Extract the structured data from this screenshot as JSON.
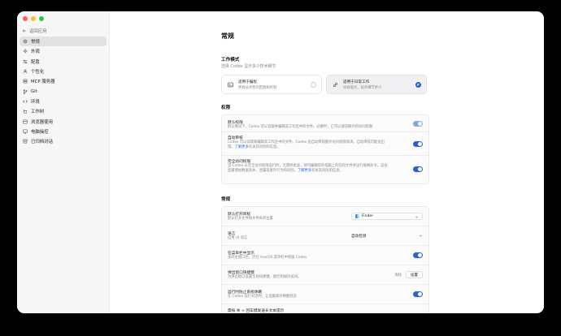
{
  "colors": {
    "accent": "#2a62d0",
    "close": "#ff5f57",
    "minimize": "#febc2e",
    "maximize": "#28c840"
  },
  "sidebar": {
    "back_label": "返回应用",
    "items": [
      {
        "label": "常规",
        "icon": "gear-icon",
        "active": true
      },
      {
        "label": "外观",
        "icon": "sun-icon"
      },
      {
        "label": "配置",
        "icon": "sliders-icon"
      },
      {
        "label": "个性化",
        "icon": "user-icon"
      },
      {
        "label": "MCP 服务器",
        "icon": "server-icon"
      },
      {
        "label": "Git",
        "icon": "git-branch-icon"
      },
      {
        "label": "环境",
        "icon": "code-icon"
      },
      {
        "label": "工作树",
        "icon": "tree-icon"
      },
      {
        "label": "浏览器使用",
        "icon": "browser-icon"
      },
      {
        "label": "电脑操控",
        "icon": "monitor-icon"
      },
      {
        "label": "已归档对话",
        "icon": "archive-icon"
      }
    ]
  },
  "main": {
    "title": "常规",
    "work_mode": {
      "title": "工作模式",
      "subtitle": "选择 Codex 显示多少技术细节",
      "options": [
        {
          "title": "适用于编程",
          "desc": "更具技术性的回复和控制",
          "icon": "terminal-icon",
          "selected": false
        },
        {
          "title": "适用于日常工作",
          "desc": "同样强大，技术细节更少",
          "icon": "link-icon",
          "selected": true
        }
      ]
    },
    "permissions": {
      "title": "权限",
      "rows": [
        {
          "title": "默认权限",
          "desc": "默认情况下，Codex 可以读取并编辑其工作区中的文件。必要时，它可以请求额外的访问权限",
          "link": "",
          "desc_after": "",
          "toggle": "dim"
        },
        {
          "title": "自动审核",
          "desc": "Codex 可以读取和编辑其工作区中的文件。Codex 会自动审核额外访问权限请求。自动审核可能会出错。",
          "link": "了解更多",
          "desc_after": "有关其风险的信息。",
          "toggle": "on"
        },
        {
          "title": "完全访问权限",
          "desc": "当 Codex 以完全访问权限运行时，无需经批准，即可编辑您的电脑上的任何文件并运行联网命令。这会显著增加数据丢失、泄露或意外行为的风险。",
          "link": "了解更多",
          "desc_after": "有关其风险的信息。",
          "toggle": "on"
        }
      ]
    },
    "general": {
      "title": "常规",
      "rows": [
        {
          "title": "默认打开目标",
          "desc": "默认打开文件和文件夹的位置",
          "control": "select",
          "value": "Finder"
        },
        {
          "title": "语言",
          "desc": "应用 UI 语言",
          "control": "select-plain",
          "value": "自动检测"
        },
        {
          "title": "在菜单栏中显示",
          "desc": "关闭主窗口后，仍在 macOS 菜单栏中保留 Codex",
          "control": "toggle"
        },
        {
          "title": "弹出窗口快捷键",
          "desc": "为弹出窗口设置全局快捷键。留空则保持关闭。",
          "control": "button",
          "clear": "清除",
          "button": "设置"
        },
        {
          "title": "运行时防止系统休眠",
          "desc": "在 Codex 运行对话时，让电脑保持唤醒状态",
          "control": "toggle"
        },
        {
          "title": "需按 ⌘ + 回车键发送长文本提示",
          "desc": "",
          "control": "none"
        }
      ]
    }
  }
}
